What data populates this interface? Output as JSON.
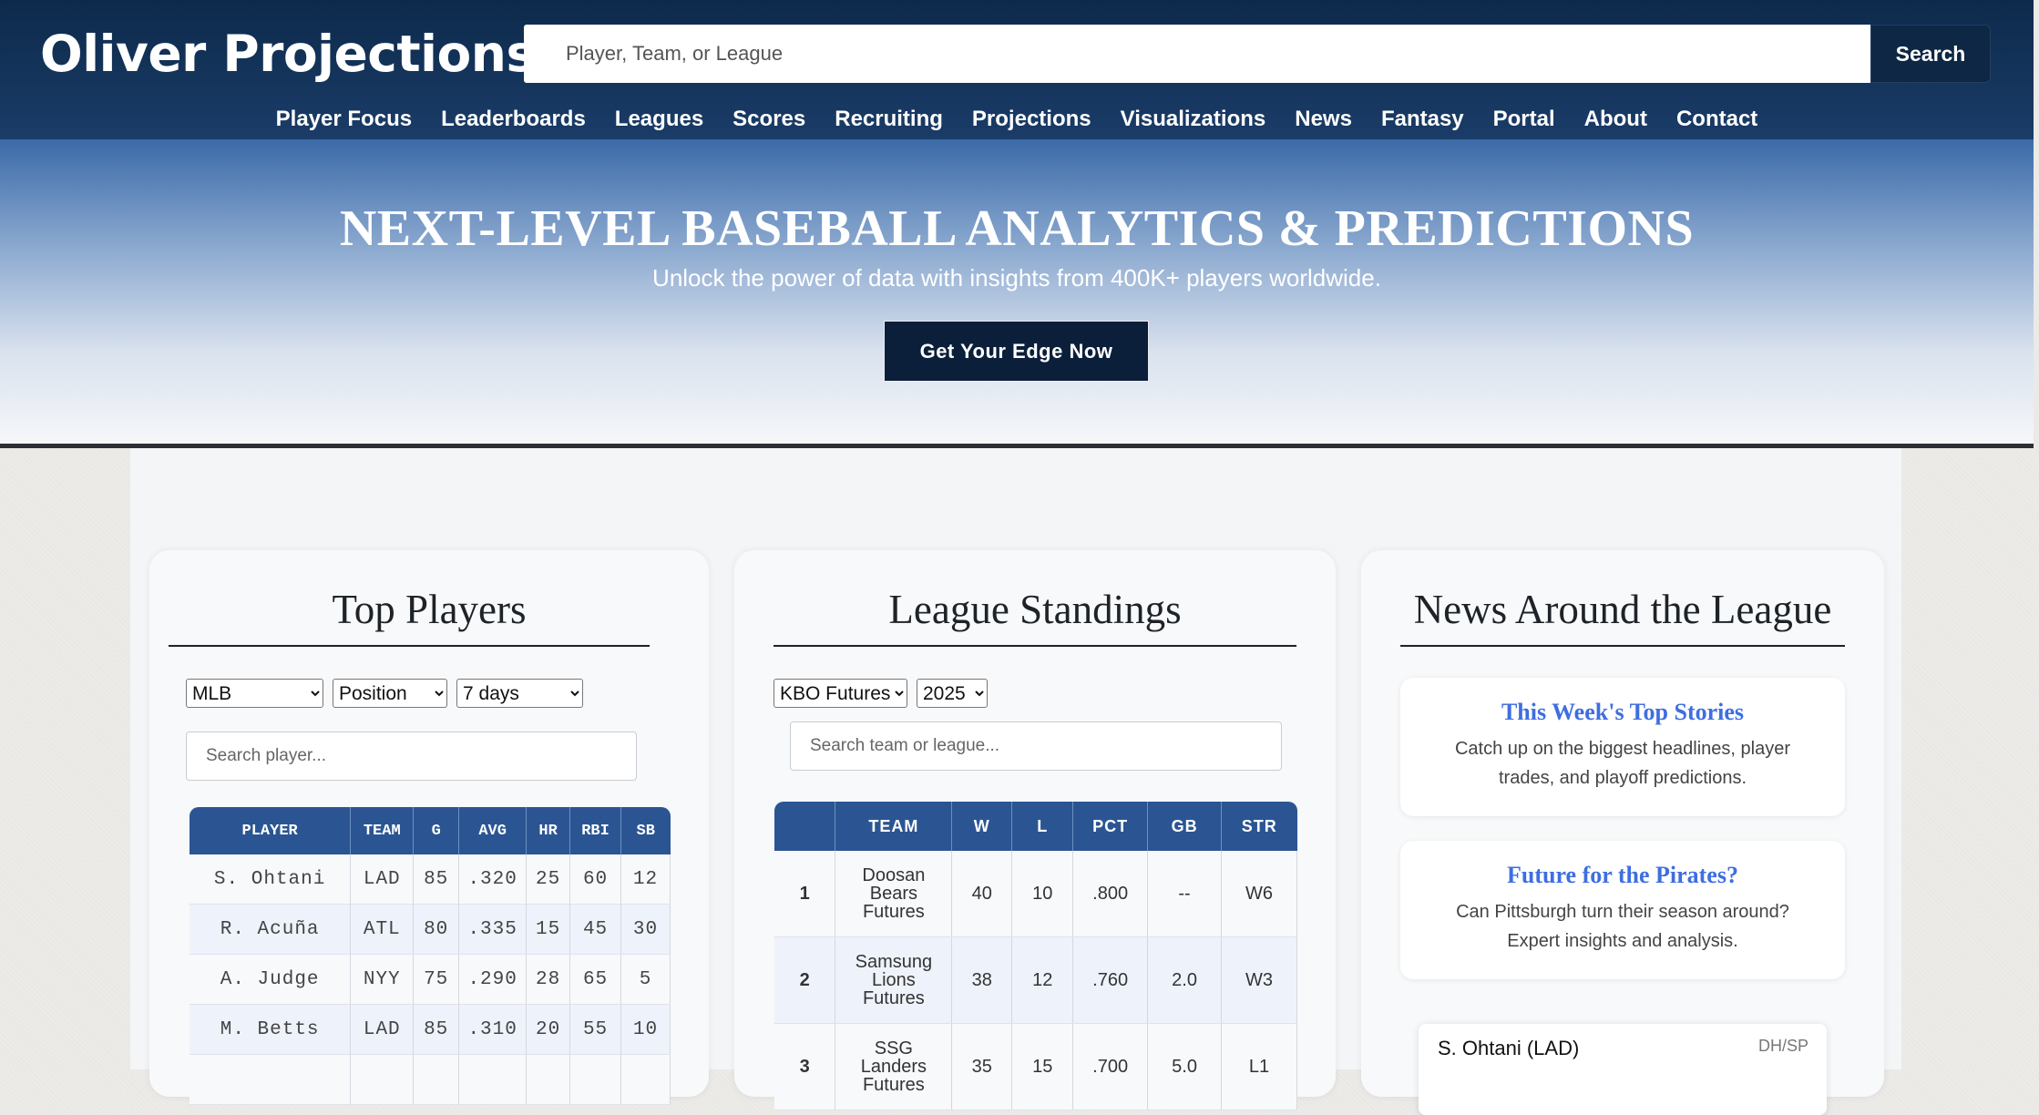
{
  "header": {
    "logo": "Oliver Projections",
    "search_placeholder": "Player, Team, or League",
    "search_button": "Search",
    "nav": [
      "Player Focus",
      "Leaderboards",
      "Leagues",
      "Scores",
      "Recruiting",
      "Projections",
      "Visualizations",
      "News",
      "Fantasy",
      "Portal",
      "About",
      "Contact"
    ]
  },
  "hero": {
    "title": "NEXT-LEVEL BASEBALL ANALYTICS & PREDICTIONS",
    "subtitle": "Unlock the power of data with insights from 400K+ players worldwide.",
    "cta": "Get Your Edge Now"
  },
  "top_players": {
    "title": "Top Players",
    "league_select": "MLB",
    "position_select": "Position",
    "range_select": "7 days",
    "search_placeholder": "Search player...",
    "columns": [
      "PLAYER",
      "TEAM",
      "G",
      "AVG",
      "HR",
      "RBI",
      "SB"
    ],
    "rows": [
      [
        "S. Ohtani",
        "LAD",
        "85",
        ".320",
        "25",
        "60",
        "12"
      ],
      [
        "R. Acuña",
        "ATL",
        "80",
        ".335",
        "15",
        "45",
        "30"
      ],
      [
        "A. Judge",
        "NYY",
        "75",
        ".290",
        "28",
        "65",
        "5"
      ],
      [
        "M. Betts",
        "LAD",
        "85",
        ".310",
        "20",
        "55",
        "10"
      ]
    ]
  },
  "standings": {
    "title": "League Standings",
    "league_select": "KBO Futures",
    "year_select": "2025",
    "search_placeholder": "Search team or league...",
    "columns": [
      "",
      "TEAM",
      "W",
      "L",
      "PCT",
      "GB",
      "STR"
    ],
    "rows": [
      [
        "1",
        "Doosan Bears Futures",
        "40",
        "10",
        ".800",
        "--",
        "W6"
      ],
      [
        "2",
        "Samsung Lions Futures",
        "38",
        "12",
        ".760",
        "2.0",
        "W3"
      ],
      [
        "3",
        "SSG Landers Futures",
        "35",
        "15",
        ".700",
        "5.0",
        "L1"
      ]
    ]
  },
  "news": {
    "title": "News Around the League",
    "stories": [
      {
        "headline": "This Week's Top Stories",
        "body": "Catch up on the biggest headlines, player trades, and playoff predictions."
      },
      {
        "headline": "Future for the Pirates?",
        "body": "Can Pittsburgh turn their season around? Expert insights and analysis."
      }
    ],
    "player_card": {
      "name": "S. Ohtani (LAD)",
      "position": "DH/SP"
    }
  }
}
